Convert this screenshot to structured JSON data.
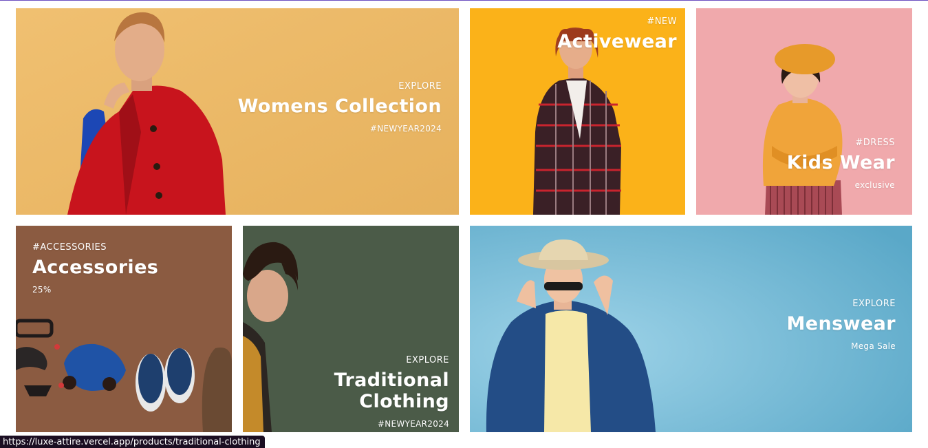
{
  "tiles": {
    "womens": {
      "kicker": "EXPLORE",
      "title": "Womens Collection",
      "note": "#NEWYEAR2024"
    },
    "activewear": {
      "kicker": "#NEW",
      "title": "Activewear"
    },
    "kids": {
      "kicker": "#DRESS",
      "title": "Kids Wear",
      "note": "exclusive"
    },
    "accessories": {
      "kicker": "#ACCESSORIES",
      "title": "Accessories",
      "note": "25%"
    },
    "traditional": {
      "kicker": "EXPLORE",
      "title": "Traditional Clothing",
      "note": "#NEWYEAR2024"
    },
    "menswear": {
      "kicker": "EXPLORE",
      "title": "Menswear",
      "note": "Mega Sale"
    }
  },
  "status_bar": {
    "url": "https://luxe-attire.vercel.app/products/traditional-clothing"
  },
  "colors": {
    "womens_bg": "#ebb863",
    "activewear_bg": "#fbb219",
    "kids_bg": "#f0a9ac",
    "accessories_bg": "#8a5a3f",
    "traditional_bg": "#4a5b47",
    "menswear_bg": "#6fb8d6"
  }
}
